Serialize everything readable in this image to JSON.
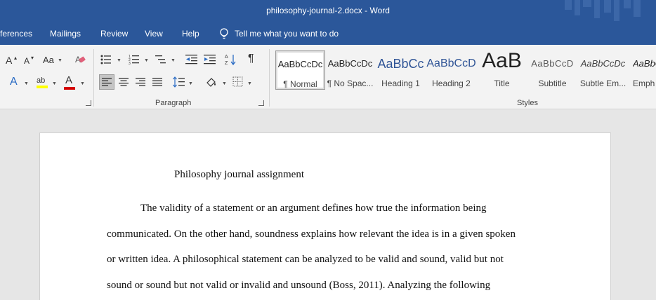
{
  "window": {
    "title": "philosophy-journal-2.docx  -  Word"
  },
  "tabs": [
    "ferences",
    "Mailings",
    "Review",
    "View",
    "Help"
  ],
  "tell_me": "Tell me what you want to do",
  "ribbon": {
    "groups": {
      "paragraph": "Paragraph",
      "styles": "Styles"
    },
    "font_size_up": "A",
    "font_size_down": "A",
    "change_case": "Aa",
    "highlight_label": "ab",
    "font_color_label": "A",
    "text_effects_label": "A",
    "pilcrow": "¶",
    "highlight_color": "#ffff00",
    "font_color": "#d40000"
  },
  "styles": [
    {
      "preview": "AaBbCcDc",
      "name": "¶ Normal"
    },
    {
      "preview": "AaBbCcDc",
      "name": "¶ No Spac..."
    },
    {
      "preview": "AaBbCc",
      "name": "Heading 1"
    },
    {
      "preview": "AaBbCcD",
      "name": "Heading 2"
    },
    {
      "preview": "AaB",
      "name": "Title"
    },
    {
      "preview": "AaBbCcD",
      "name": "Subtitle"
    },
    {
      "preview": "AaBbCcDc",
      "name": "Subtle Em..."
    },
    {
      "preview": "AaBbC",
      "name": "Emph"
    }
  ],
  "document": {
    "title": "Philosophy journal assignment",
    "lines": [
      "The validity of a statement or an argument defines how true the information being",
      "communicated. On the other hand, soundness explains how relevant the idea is in a given spoken",
      "or written idea. A philosophical statement can be analyzed to be valid and sound, valid but not",
      "sound or sound but not valid or invalid and unsound (Boss, 2011). Analyzing the following"
    ]
  },
  "colors": {
    "titlebar": "#2b579a",
    "ribbon": "#f3f3f3",
    "canvas": "#e6e6e6",
    "heading_blue": "#2f5496"
  }
}
